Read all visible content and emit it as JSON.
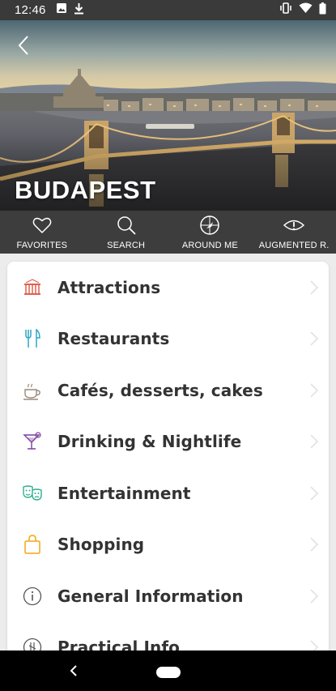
{
  "status_bar": {
    "time": "12:46",
    "left_icons": [
      "image-icon",
      "download-icon"
    ],
    "right_icons": [
      "vibrate-icon",
      "wifi-icon",
      "battery-icon"
    ]
  },
  "hero": {
    "title": "BUDAPEST",
    "back_icon": "chevron-left-icon"
  },
  "quick_actions": [
    {
      "label": "FAVORITES",
      "icon": "heart-icon"
    },
    {
      "label": "SEARCH",
      "icon": "search-icon"
    },
    {
      "label": "AROUND ME",
      "icon": "compass-icon"
    },
    {
      "label": "AUGMENTED R.",
      "icon": "eye-icon"
    }
  ],
  "categories": [
    {
      "label": "Attractions",
      "icon": "building-icon",
      "color": "#e0604e"
    },
    {
      "label": "Restaurants",
      "icon": "cutlery-icon",
      "color": "#2aa6c6"
    },
    {
      "label": "Cafés, desserts, cakes",
      "icon": "coffee-cup-icon",
      "color": "#9a8a7a"
    },
    {
      "label": "Drinking & Nightlife",
      "icon": "cocktail-icon",
      "color": "#7b3fa0"
    },
    {
      "label": "Entertainment",
      "icon": "masks-icon",
      "color": "#2fae8e"
    },
    {
      "label": "Shopping",
      "icon": "shopping-bag-icon",
      "color": "#f2a619"
    },
    {
      "label": "General Information",
      "icon": "info-icon",
      "color": "#555555"
    },
    {
      "label": "Practical Info",
      "icon": "practical-info-icon",
      "color": "#555555"
    }
  ]
}
